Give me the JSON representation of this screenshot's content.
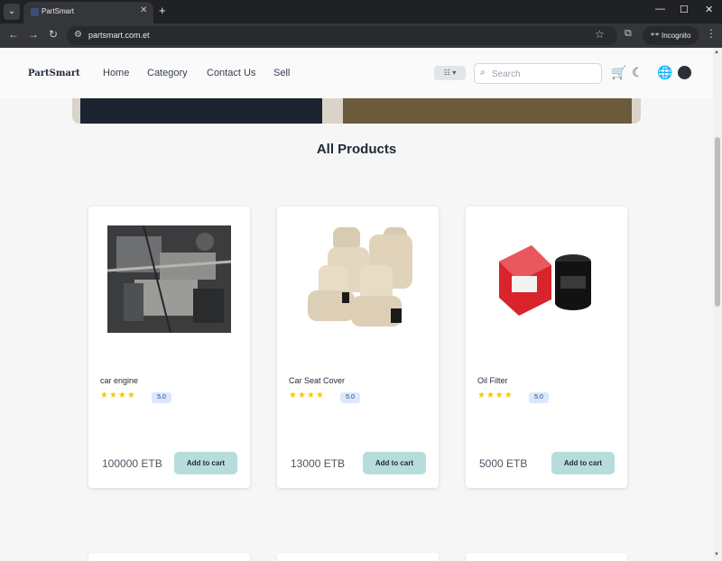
{
  "browser": {
    "tab_title": "PartSmart",
    "url": "partsmart.com.et",
    "incognito_label": "Incognito"
  },
  "site": {
    "brand": "PartSmart",
    "nav": [
      "Home",
      "Category",
      "Contact Us",
      "Sell"
    ],
    "search_placeholder": "Search"
  },
  "section_title": "All Products",
  "products": [
    {
      "name": "car engine",
      "rating": "5.0",
      "price": "100000 ETB",
      "button": "Add to cart"
    },
    {
      "name": "Car Seat Cover",
      "rating": "5.0",
      "price": "13000 ETB",
      "button": "Add to cart"
    },
    {
      "name": "Oil Filter",
      "rating": "5.0",
      "price": "5000 ETB",
      "button": "Add to cart"
    }
  ],
  "stars": "★★★★",
  "colors": {
    "accent_button": "#b7dcdc",
    "star": "#f5c518",
    "badge": "#dbe7fb"
  }
}
